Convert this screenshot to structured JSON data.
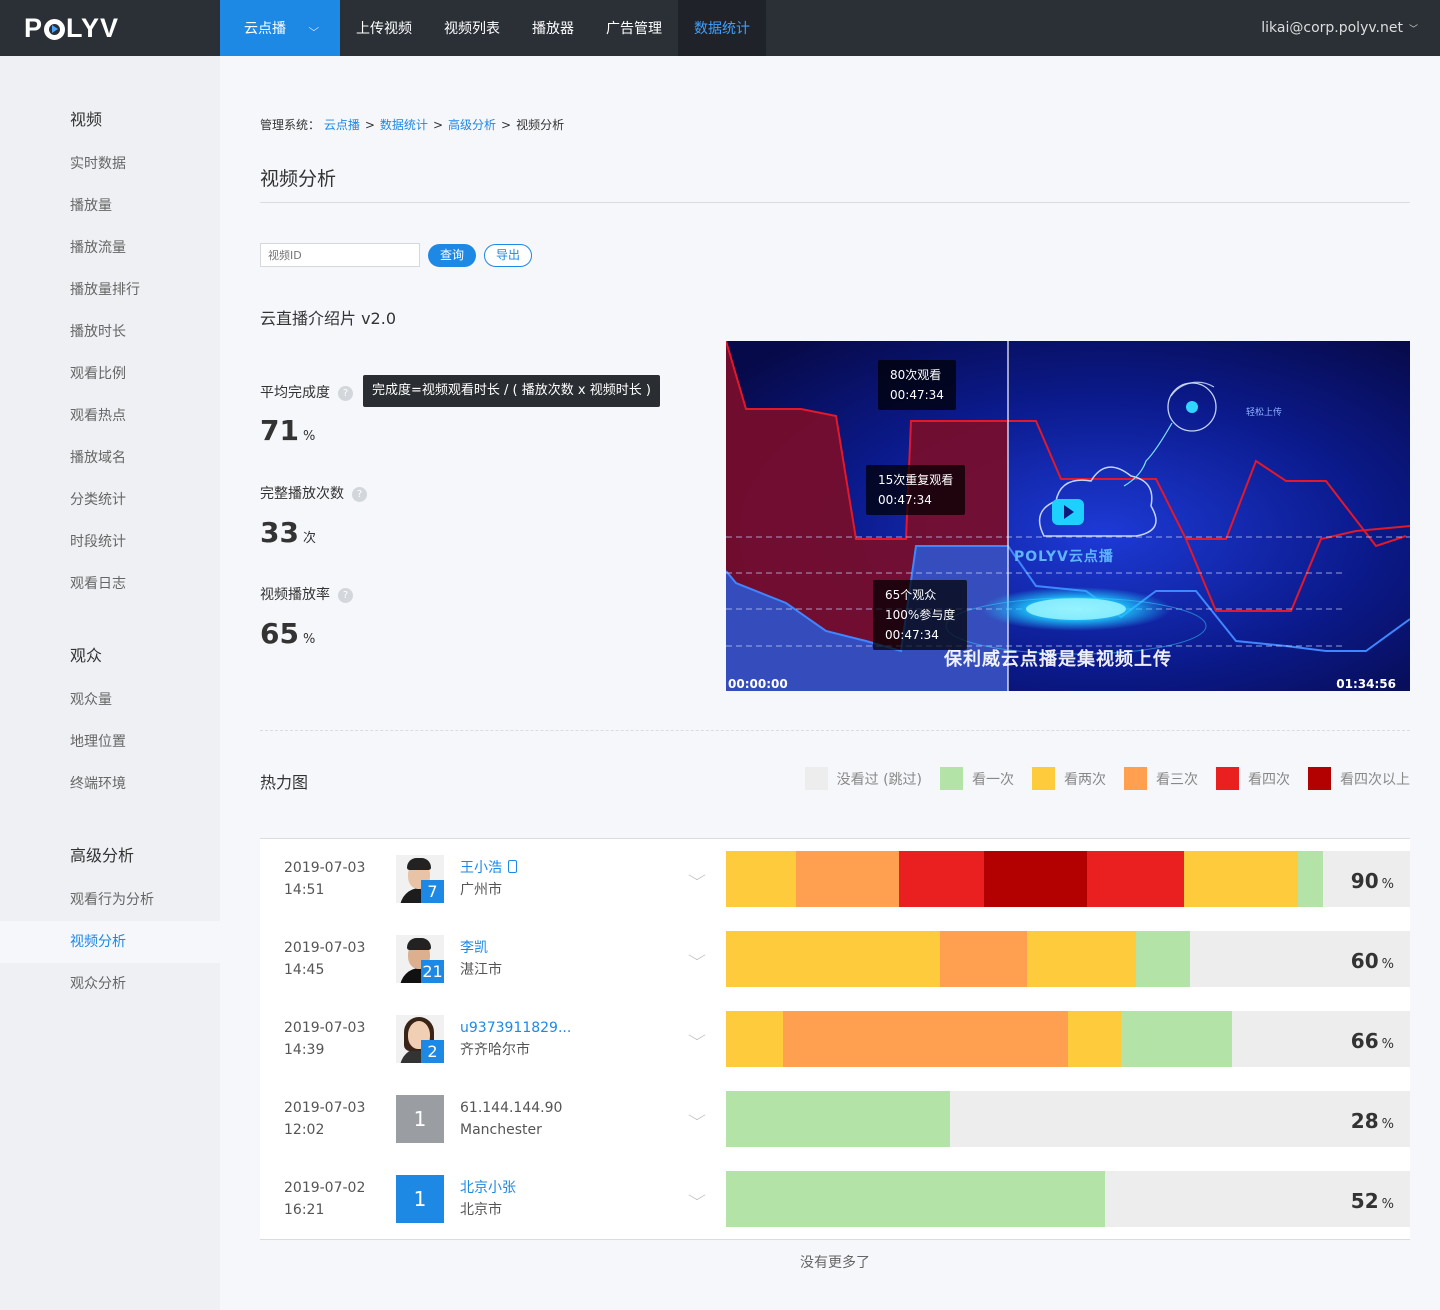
{
  "app": {
    "logo": "POLYV",
    "nav_main": "云点播",
    "nav": [
      "上传视频",
      "视频列表",
      "播放器",
      "广告管理",
      "数据统计"
    ],
    "user": "likai@corp.polyv.net"
  },
  "sidebar": {
    "groups": [
      {
        "title": "视频",
        "items": [
          "实时数据",
          "播放量",
          "播放流量",
          "播放量排行",
          "播放时长",
          "观看比例",
          "观看热点",
          "播放域名",
          "分类统计",
          "时段统计",
          "观看日志"
        ]
      },
      {
        "title": "观众",
        "items": [
          "观众量",
          "地理位置",
          "终端环境"
        ]
      },
      {
        "title": "高级分析",
        "items": [
          "观看行为分析",
          "视频分析",
          "观众分析"
        ]
      }
    ],
    "active": "视频分析"
  },
  "breadcrumb": {
    "prefix": "管理系统：",
    "links": [
      "云点播",
      "数据统计",
      "高级分析"
    ],
    "current": "视频分析"
  },
  "page_title": "视频分析",
  "search": {
    "placeholder": "视频ID",
    "query_label": "查询",
    "export_label": "导出"
  },
  "video_title": "云直播介绍片 v2.0",
  "metrics": [
    {
      "label": "平均完成度",
      "value": "71",
      "unit": "%"
    },
    {
      "label": "完整播放次数",
      "value": "33",
      "unit": "次"
    },
    {
      "label": "视频播放率",
      "value": "65",
      "unit": "%"
    }
  ],
  "tooltip": "完成度=视频观看时长 / ( 播放次数 x 视频时长 )",
  "preview": {
    "start": "00:00:00",
    "end": "01:34:56",
    "tips": [
      {
        "line1": "80次观看",
        "line2": "00:47:34"
      },
      {
        "line1": "15次重复观看",
        "line2": "00:47:34"
      },
      {
        "line1": "65个观众",
        "line2": "100%参与度",
        "line3": "00:47:34"
      }
    ],
    "subtitle": "保利威云点播是集视频上传",
    "watermark": "POLYV云点播",
    "cloud_label": "轻松上传"
  },
  "heatmap": {
    "title": "热力图",
    "legend": [
      {
        "label": "没看过 (跳过)",
        "color": "#ededed"
      },
      {
        "label": "看一次",
        "color": "#b3e3a6"
      },
      {
        "label": "看两次",
        "color": "#fecb3c"
      },
      {
        "label": "看三次",
        "color": "#fea04f"
      },
      {
        "label": "看四次",
        "color": "#ea1f1f"
      },
      {
        "label": "看四次以上",
        "color": "#b30000"
      }
    ]
  },
  "rows": [
    {
      "date": "2019-07-03",
      "time": "14:51",
      "name": "王小浩",
      "city": "广州市",
      "badge": "7",
      "avatar": "photo",
      "phone": true,
      "pct": "90",
      "segments": [
        {
          "c": "#fecb3c",
          "w": 70
        },
        {
          "c": "#fea04f",
          "w": 103
        },
        {
          "c": "#ea1f1f",
          "w": 85
        },
        {
          "c": "#b30000",
          "w": 103
        },
        {
          "c": "#ea1f1f",
          "w": 97
        },
        {
          "c": "#fecb3c",
          "w": 114
        },
        {
          "c": "#b3e3a6",
          "w": 25
        }
      ]
    },
    {
      "date": "2019-07-03",
      "time": "14:45",
      "name": "李凯",
      "city": "湛江市",
      "badge": "21",
      "avatar": "photo",
      "phone": false,
      "pct": "60",
      "segments": [
        {
          "c": "#fecb3c",
          "w": 214
        },
        {
          "c": "#fea04f",
          "w": 87
        },
        {
          "c": "#fecb3c",
          "w": 109
        },
        {
          "c": "#b3e3a6",
          "w": 54
        }
      ]
    },
    {
      "date": "2019-07-03",
      "time": "14:39",
      "name": "u9373911829...",
      "city": "齐齐哈尔市",
      "badge": "2",
      "avatar": "photo-f",
      "phone": false,
      "pct": "66",
      "segments": [
        {
          "c": "#fecb3c",
          "w": 57
        },
        {
          "c": "#fea04f",
          "w": 285
        },
        {
          "c": "#fecb3c",
          "w": 53
        },
        {
          "c": "#b3e3a6",
          "w": 111
        }
      ]
    },
    {
      "date": "2019-07-03",
      "time": "12:02",
      "name": "61.144.144.90",
      "city": "Manchester",
      "badge": "1",
      "avatar": "gray",
      "phone": false,
      "pct": "28",
      "segments": [
        {
          "c": "#b3e3a6",
          "w": 224
        }
      ]
    },
    {
      "date": "2019-07-02",
      "time": "16:21",
      "name": "北京小张",
      "city": "北京市",
      "badge": "1",
      "avatar": "blue",
      "phone": false,
      "pct": "52",
      "segments": [
        {
          "c": "#b3e3a6",
          "w": 379
        }
      ]
    }
  ],
  "no_more": "没有更多了"
}
